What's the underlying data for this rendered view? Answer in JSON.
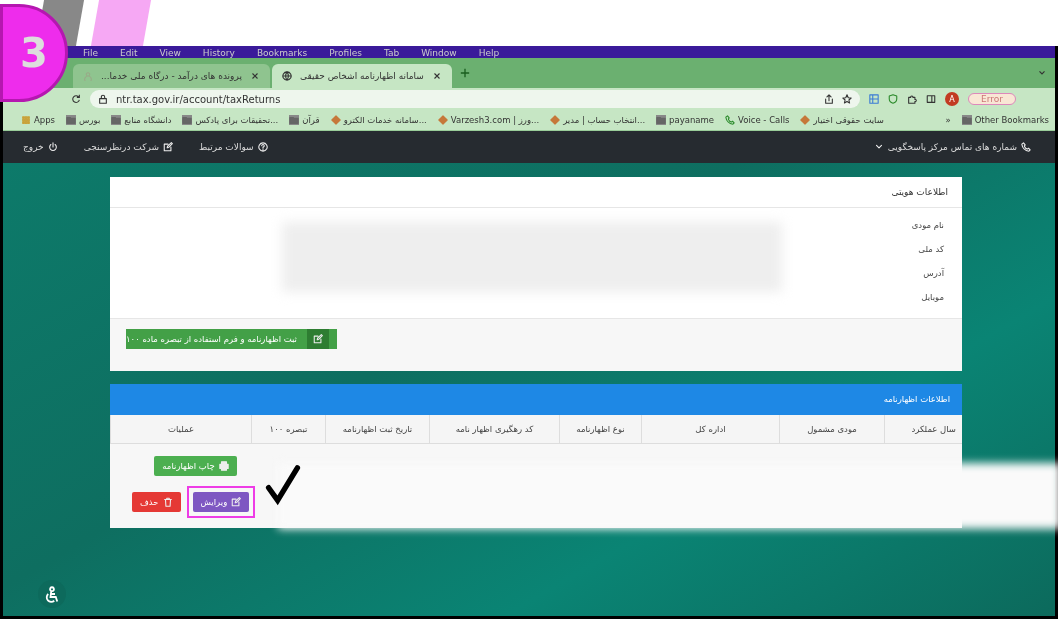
{
  "overlay": {
    "step_number": "3"
  },
  "menu_bar": {
    "items": [
      "Help",
      "Window",
      "Tab",
      "Profiles",
      "Bookmarks",
      "History",
      "View",
      "Edit",
      "File"
    ]
  },
  "browser": {
    "tabs": [
      {
        "title": "سامانه اظهارنامه اشخاص حقیقی",
        "selected": true
      },
      {
        "title": "پرونده های درآمد - درگاه ملی خدما...",
        "selected": false
      }
    ],
    "url": "ntr.tax.gov.ir/account/taxReturns",
    "error_label": "Error",
    "profile_initial": "A",
    "bookmarks": [
      {
        "label": "Other Bookmarks",
        "kind": "folder"
      },
      {
        "label": "»",
        "kind": "more"
      },
      {
        "label": "سایت حقوقی اختیار",
        "kind": "site"
      },
      {
        "label": "Voice - Calls",
        "kind": "phone"
      },
      {
        "label": "payaname",
        "kind": "folder"
      },
      {
        "label": "انتخاب حساب | مدیر...",
        "kind": "site"
      },
      {
        "label": "Varzesh3.com | ورز...",
        "kind": "site"
      },
      {
        "label": "سامانه خدمات الکترو...",
        "kind": "site"
      },
      {
        "label": "قرآن",
        "kind": "folder"
      },
      {
        "label": "تحقیقات برای پادکس...",
        "kind": "folder"
      },
      {
        "label": "دانشگاه منابع",
        "kind": "folder"
      },
      {
        "label": "بورس",
        "kind": "folder"
      },
      {
        "label": "Apps",
        "kind": "apps"
      }
    ]
  },
  "navbar": {
    "contact": "شماره های تماس مرکز پاسخگویی",
    "links": [
      {
        "label": "سوالات مرتبط",
        "kind": "help"
      },
      {
        "label": "شرکت درنظرسنجی",
        "kind": "edit"
      },
      {
        "label": "خروج",
        "kind": "power"
      }
    ]
  },
  "identity_card": {
    "title": "اطلاعات هویتی",
    "fields": [
      "نام مودی",
      "کد ملی",
      "آدرس",
      "موبایل"
    ],
    "submit_button": "ثبت اظهارنامه و فرم استفاده از تبصره ماده ۱۰۰"
  },
  "returns_card": {
    "title": "اطلاعات اظهارنامه",
    "columns": [
      "سال عملکرد",
      "مودی مشمول",
      "اداره کل",
      "نوع اظهارنامه",
      "کد رهگیری اظهار نامه",
      "تاریخ ثبت اظهارنامه",
      "تبصره ۱۰۰",
      "عملیات"
    ],
    "actions": [
      {
        "label": "چاپ اظهارنامه",
        "kind": "print",
        "highlighted": false
      },
      {
        "label": "ویرایش",
        "kind": "edit",
        "highlighted": true
      },
      {
        "label": "حذف",
        "kind": "delete",
        "highlighted": false
      }
    ]
  }
}
